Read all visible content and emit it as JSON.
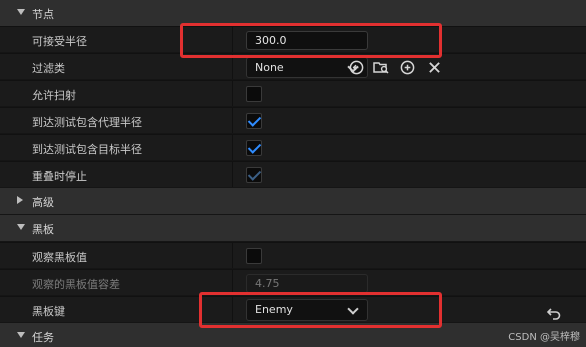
{
  "sections": {
    "node_title": "节点",
    "advanced_title": "高级",
    "blackboard_title": "黑板",
    "task_title": "任务"
  },
  "props": {
    "acceptable_radius_label": "可接受半径",
    "acceptable_radius_value": "300.0",
    "filter_class_label": "过滤类",
    "filter_class_value": "None",
    "allow_strafe_label": "允许扫射",
    "include_agent_radius_label": "到达测试包含代理半径",
    "include_target_radius_label": "到达测试包含目标半径",
    "stop_on_overlap_label": "重叠时停止",
    "observe_blackboard_label": "观察黑板值",
    "blackboard_tolerance_label": "观察的黑板值容差",
    "blackboard_tolerance_value": "4.75",
    "blackboard_key_label": "黑板键",
    "blackboard_key_value": "Enemy"
  },
  "checkboxes": {
    "allow_strafe": false,
    "include_agent_radius": true,
    "include_target_radius": true,
    "stop_on_overlap": true,
    "observe_blackboard": false
  },
  "icons": [
    "chevron-down-icon",
    "chevron-right-icon",
    "use-selected-icon",
    "browse-icon",
    "add-icon",
    "clear-icon",
    "reset-icon"
  ],
  "colors": {
    "checkbox_accent": "#2f8cff",
    "highlight": "#e23030"
  },
  "footer": "CSDN @吴梓穆"
}
